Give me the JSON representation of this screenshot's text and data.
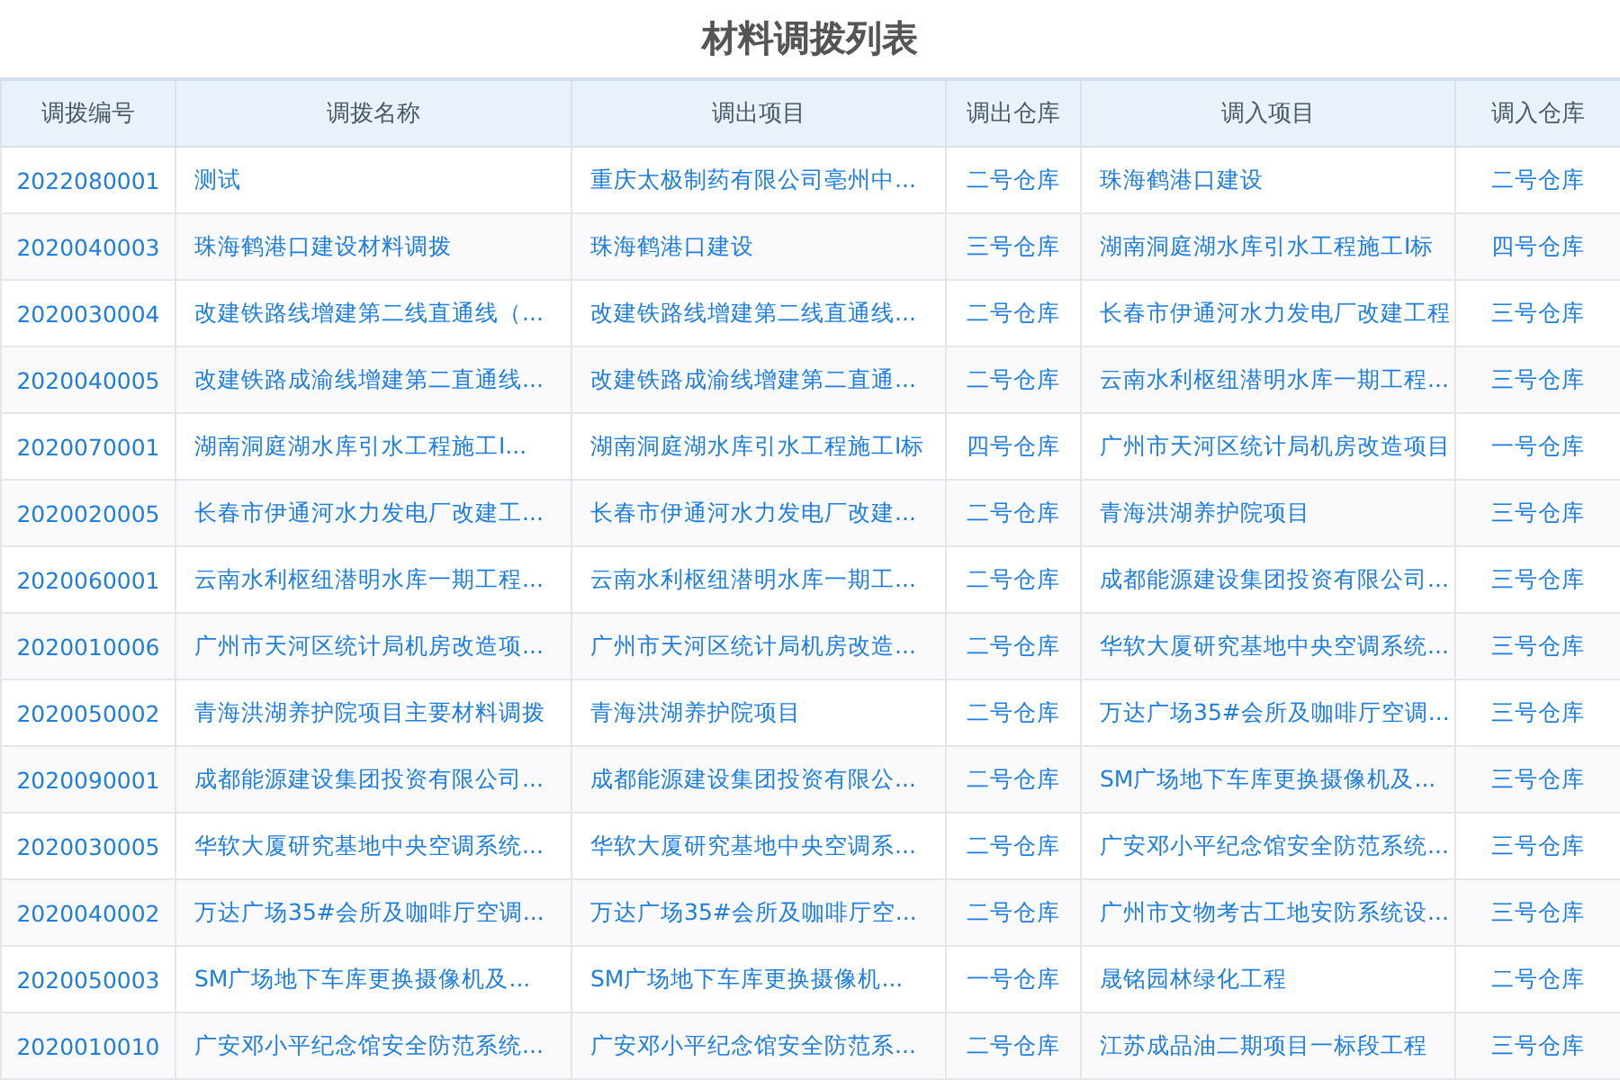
{
  "title": "材料调拨列表",
  "table": {
    "columns": [
      "调拨编号",
      "调拨名称",
      "调出项目",
      "调出仓库",
      "调入项目",
      "调入仓库"
    ],
    "rows": [
      [
        "2022080001",
        "测试",
        "重庆太极制药有限公司亳州中...",
        "二号仓库",
        "珠海鹤港口建设",
        "二号仓库"
      ],
      [
        "2020040003",
        "珠海鹤港口建设材料调拨",
        "珠海鹤港口建设",
        "三号仓库",
        "湖南洞庭湖水库引水工程施工I标",
        "四号仓库"
      ],
      [
        "2020030004",
        "改建铁路线增建第二线直通线（...",
        "改建铁路线增建第二线直通线...",
        "二号仓库",
        "长春市伊通河水力发电厂改建工程",
        "三号仓库"
      ],
      [
        "2020040005",
        "改建铁路成渝线增建第二直通线...",
        "改建铁路成渝线增建第二直通...",
        "二号仓库",
        "云南水利枢纽潜明水库一期工程...",
        "三号仓库"
      ],
      [
        "2020070001",
        "湖南洞庭湖水库引水工程施工I...",
        "湖南洞庭湖水库引水工程施工I标",
        "四号仓库",
        "广州市天河区统计局机房改造项目",
        "一号仓库"
      ],
      [
        "2020020005",
        "长春市伊通河水力发电厂改建工...",
        "长春市伊通河水力发电厂改建...",
        "二号仓库",
        "青海洪湖养护院项目",
        "三号仓库"
      ],
      [
        "2020060001",
        "云南水利枢纽潜明水库一期工程...",
        "云南水利枢纽潜明水库一期工...",
        "二号仓库",
        "成都能源建设集团投资有限公司...",
        "三号仓库"
      ],
      [
        "2020010006",
        "广州市天河区统计局机房改造项...",
        "广州市天河区统计局机房改造...",
        "二号仓库",
        "华软大厦研究基地中央空调系统...",
        "三号仓库"
      ],
      [
        "2020050002",
        "青海洪湖养护院项目主要材料调拨",
        "青海洪湖养护院项目",
        "二号仓库",
        "万达广场35#会所及咖啡厅空调...",
        "三号仓库"
      ],
      [
        "2020090001",
        "成都能源建设集团投资有限公司...",
        "成都能源建设集团投资有限公...",
        "二号仓库",
        "SM广场地下车库更换摄像机及...",
        "三号仓库"
      ],
      [
        "2020030005",
        "华软大厦研究基地中央空调系统...",
        "华软大厦研究基地中央空调系...",
        "二号仓库",
        "广安邓小平纪念馆安全防范系统...",
        "三号仓库"
      ],
      [
        "2020040002",
        "万达广场35#会所及咖啡厅空调...",
        "万达广场35#会所及咖啡厅空...",
        "二号仓库",
        "广州市文物考古工地安防系统设...",
        "三号仓库"
      ],
      [
        "2020050003",
        "SM广场地下车库更换摄像机及...",
        "SM广场地下车库更换摄像机...",
        "一号仓库",
        "晟铭园林绿化工程",
        "二号仓库"
      ],
      [
        "2020010010",
        "广安邓小平纪念馆安全防范系统...",
        "广安邓小平纪念馆安全防范系...",
        "二号仓库",
        "江苏成品油二期项目一标段工程",
        "三号仓库"
      ]
    ]
  }
}
